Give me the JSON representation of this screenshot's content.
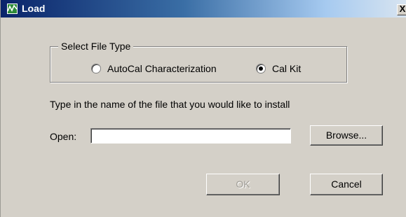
{
  "window": {
    "title": "Load",
    "close_label": "X"
  },
  "file_type_group": {
    "legend": "Select File Type",
    "options": [
      {
        "label": "AutoCal Characterization",
        "selected": false
      },
      {
        "label": "Cal Kit",
        "selected": true
      }
    ]
  },
  "instruction_text": "Type in the name of the file that you would like to install",
  "open_field": {
    "label": "Open:",
    "value": ""
  },
  "buttons": {
    "browse": "Browse...",
    "ok": "OK",
    "cancel": "Cancel"
  },
  "colors": {
    "dialog_background": "#d4d0c8",
    "titlebar_start": "#0a246a",
    "titlebar_end": "#d8e4f0",
    "disabled_text": "#a09d96"
  },
  "icons": {
    "app_icon": "chart-wave-icon",
    "close_icon": "close-icon"
  },
  "state": {
    "ok_enabled": false
  }
}
